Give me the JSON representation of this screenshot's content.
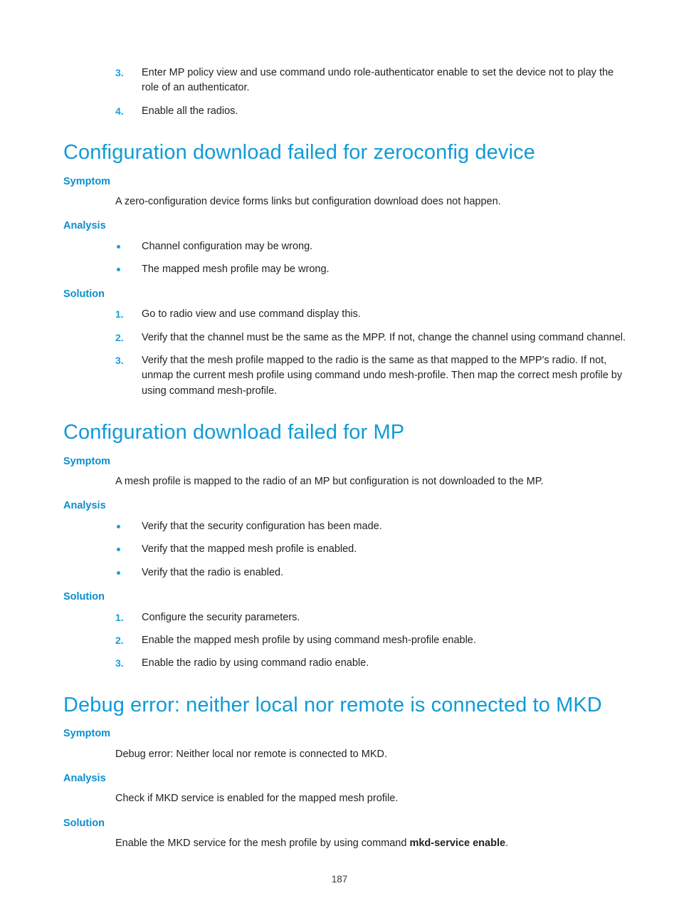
{
  "page": {
    "number": "187"
  },
  "top_list": {
    "items": [
      {
        "marker": "3.",
        "text": "Enter MP policy view and use command undo role-authenticator enable to set the device not to play the role of an authenticator."
      },
      {
        "marker": "4.",
        "text": "Enable all the radios."
      }
    ]
  },
  "sections": [
    {
      "heading": "Configuration download failed for zeroconfig device",
      "symptom_label": "Symptom",
      "symptom_text": "A zero-configuration device forms links but configuration download does not happen.",
      "analysis_label": "Analysis",
      "analysis_bullets": [
        "Channel configuration may be wrong.",
        "The mapped mesh profile may be wrong."
      ],
      "solution_label": "Solution",
      "solution_items": [
        {
          "marker": "1.",
          "text": "Go to radio view and use command display this."
        },
        {
          "marker": "2.",
          "text": "Verify that the channel must be the same as the MPP. If not, change the channel using command channel."
        },
        {
          "marker": "3.",
          "text": "Verify that the mesh profile mapped to the radio is the same as that mapped to the MPP's radio. If not, unmap the current mesh profile using command undo mesh-profile. Then map the correct mesh profile by using command mesh-profile."
        }
      ]
    },
    {
      "heading": "Configuration download failed for MP",
      "symptom_label": "Symptom",
      "symptom_text": "A mesh profile is mapped to the radio of an MP but configuration is not downloaded to the MP.",
      "analysis_label": "Analysis",
      "analysis_bullets": [
        "Verify that the security configuration has been made.",
        "Verify that the mapped mesh profile is enabled.",
        "Verify that the radio is enabled."
      ],
      "solution_label": "Solution",
      "solution_items": [
        {
          "marker": "1.",
          "text": "Configure the security parameters."
        },
        {
          "marker": "2.",
          "text": "Enable the mapped mesh profile by using command mesh-profile enable."
        },
        {
          "marker": "3.",
          "text": "Enable the radio by using command radio enable."
        }
      ]
    },
    {
      "heading": "Debug error: neither local nor remote is connected to MKD",
      "symptom_label": "Symptom",
      "symptom_text": "Debug error: Neither local nor remote is connected to MKD.",
      "analysis_label": "Analysis",
      "analysis_text": "Check if MKD service is enabled for the mapped mesh profile.",
      "solution_label": "Solution",
      "solution_text_before": "Enable the MKD service for the mesh profile by using command ",
      "solution_text_bold": "mkd-service enable",
      "solution_text_after": "."
    }
  ],
  "colors": {
    "heading_blue": "#0f9bd7",
    "subheading_blue": "#0b8fcc",
    "marker_blue": "#16a0d8",
    "body_text": "#231f20"
  }
}
